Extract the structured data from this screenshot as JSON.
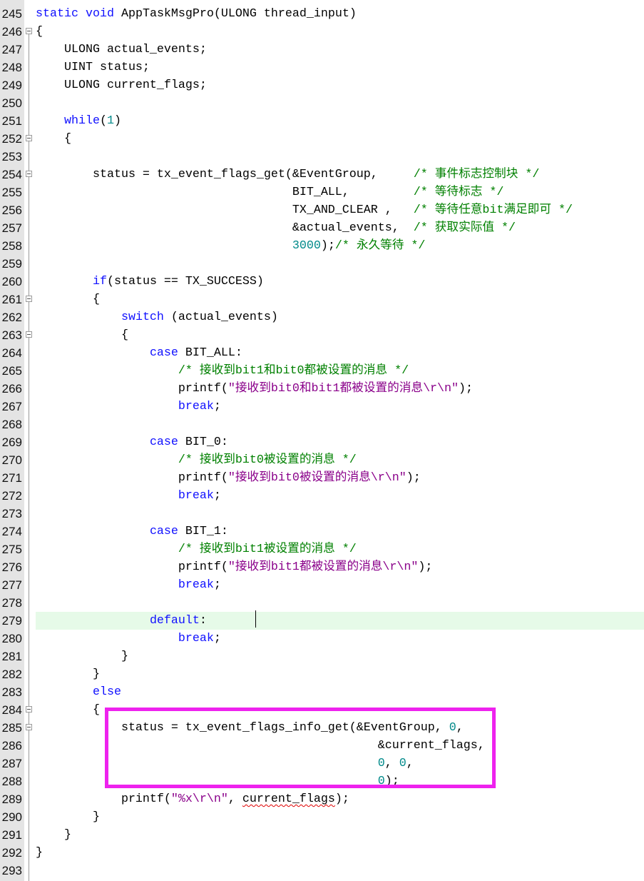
{
  "editor": {
    "highlight_line": "279",
    "annotation_box_color": "#ee22ee",
    "colors": {
      "keyword": "#1010ff",
      "number": "#008a8a",
      "comment": "#008000",
      "string": "#8a008a"
    },
    "lines": [
      {
        "num": "245",
        "segs": [
          [
            "k",
            "static"
          ],
          [
            "t",
            " "
          ],
          [
            "k",
            "void"
          ],
          [
            "t",
            " AppTaskMsgPro(ULONG thread_input)"
          ]
        ]
      },
      {
        "num": "246",
        "fold": true,
        "segs": [
          [
            "t",
            "{"
          ]
        ]
      },
      {
        "num": "247",
        "segs": [
          [
            "t",
            "    ULONG actual_events;"
          ]
        ]
      },
      {
        "num": "248",
        "segs": [
          [
            "t",
            "    UINT status;"
          ]
        ]
      },
      {
        "num": "249",
        "segs": [
          [
            "t",
            "    ULONG current_flags;"
          ]
        ]
      },
      {
        "num": "250",
        "segs": []
      },
      {
        "num": "251",
        "segs": [
          [
            "t",
            "    "
          ],
          [
            "k",
            "while"
          ],
          [
            "t",
            "("
          ],
          [
            "n",
            "1"
          ],
          [
            "t",
            ")"
          ]
        ]
      },
      {
        "num": "252",
        "fold": true,
        "segs": [
          [
            "t",
            "    {"
          ]
        ]
      },
      {
        "num": "253",
        "segs": []
      },
      {
        "num": "254",
        "fold": true,
        "segs": [
          [
            "t",
            "        status = tx_event_flags_get(&EventGroup,     "
          ],
          [
            "c",
            "/* 事件标志控制块 */"
          ]
        ]
      },
      {
        "num": "255",
        "segs": [
          [
            "t",
            "                                    BIT_ALL,         "
          ],
          [
            "c",
            "/* 等待标志 */"
          ]
        ]
      },
      {
        "num": "256",
        "segs": [
          [
            "t",
            "                                    TX_AND_CLEAR ,   "
          ],
          [
            "c",
            "/* 等待任意bit满足即可 */"
          ]
        ]
      },
      {
        "num": "257",
        "segs": [
          [
            "t",
            "                                    &actual_events,  "
          ],
          [
            "c",
            "/* 获取实际值 */"
          ]
        ]
      },
      {
        "num": "258",
        "segs": [
          [
            "t",
            "                                    "
          ],
          [
            "n",
            "3000"
          ],
          [
            "t",
            ");"
          ],
          [
            "c",
            "/* 永久等待 */"
          ]
        ]
      },
      {
        "num": "259",
        "segs": []
      },
      {
        "num": "260",
        "segs": [
          [
            "t",
            "        "
          ],
          [
            "k",
            "if"
          ],
          [
            "t",
            "(status == TX_SUCCESS)"
          ]
        ]
      },
      {
        "num": "261",
        "fold": true,
        "segs": [
          [
            "t",
            "        {"
          ]
        ]
      },
      {
        "num": "262",
        "segs": [
          [
            "t",
            "            "
          ],
          [
            "k",
            "switch"
          ],
          [
            "t",
            " (actual_events)"
          ]
        ]
      },
      {
        "num": "263",
        "fold": true,
        "segs": [
          [
            "t",
            "            {"
          ]
        ]
      },
      {
        "num": "264",
        "segs": [
          [
            "t",
            "                "
          ],
          [
            "k",
            "case"
          ],
          [
            "t",
            " BIT_ALL:"
          ]
        ]
      },
      {
        "num": "265",
        "segs": [
          [
            "t",
            "                    "
          ],
          [
            "c",
            "/* 接收到bit1和bit0都被设置的消息 */"
          ]
        ]
      },
      {
        "num": "266",
        "segs": [
          [
            "t",
            "                    printf("
          ],
          [
            "s",
            "\"接收到bit0和bit1都被设置的消息\\r\\n\""
          ],
          [
            "t",
            ");"
          ]
        ]
      },
      {
        "num": "267",
        "segs": [
          [
            "t",
            "                    "
          ],
          [
            "k",
            "break"
          ],
          [
            "t",
            ";"
          ]
        ]
      },
      {
        "num": "268",
        "segs": []
      },
      {
        "num": "269",
        "segs": [
          [
            "t",
            "                "
          ],
          [
            "k",
            "case"
          ],
          [
            "t",
            " BIT_0:"
          ]
        ]
      },
      {
        "num": "270",
        "segs": [
          [
            "t",
            "                    "
          ],
          [
            "c",
            "/* 接收到bit0被设置的消息 */"
          ]
        ]
      },
      {
        "num": "271",
        "segs": [
          [
            "t",
            "                    printf("
          ],
          [
            "s",
            "\"接收到bit0被设置的消息\\r\\n\""
          ],
          [
            "t",
            ");"
          ]
        ]
      },
      {
        "num": "272",
        "segs": [
          [
            "t",
            "                    "
          ],
          [
            "k",
            "break"
          ],
          [
            "t",
            ";"
          ]
        ]
      },
      {
        "num": "273",
        "segs": []
      },
      {
        "num": "274",
        "segs": [
          [
            "t",
            "                "
          ],
          [
            "k",
            "case"
          ],
          [
            "t",
            " BIT_1:"
          ]
        ]
      },
      {
        "num": "275",
        "segs": [
          [
            "t",
            "                    "
          ],
          [
            "c",
            "/* 接收到bit1被设置的消息 */"
          ]
        ]
      },
      {
        "num": "276",
        "segs": [
          [
            "t",
            "                    printf("
          ],
          [
            "s",
            "\"接收到bit1都被设置的消息\\r\\n\""
          ],
          [
            "t",
            ");"
          ]
        ]
      },
      {
        "num": "277",
        "segs": [
          [
            "t",
            "                    "
          ],
          [
            "k",
            "break"
          ],
          [
            "t",
            ";"
          ]
        ]
      },
      {
        "num": "278",
        "segs": []
      },
      {
        "num": "279",
        "segs": [
          [
            "t",
            "                "
          ],
          [
            "k",
            "default"
          ],
          [
            "t",
            ":"
          ]
        ]
      },
      {
        "num": "280",
        "segs": [
          [
            "t",
            "                    "
          ],
          [
            "k",
            "break"
          ],
          [
            "t",
            ";"
          ]
        ]
      },
      {
        "num": "281",
        "segs": [
          [
            "t",
            "            }"
          ]
        ]
      },
      {
        "num": "282",
        "segs": [
          [
            "t",
            "        }"
          ]
        ]
      },
      {
        "num": "283",
        "segs": [
          [
            "t",
            "        "
          ],
          [
            "k",
            "else"
          ]
        ]
      },
      {
        "num": "284",
        "fold": true,
        "segs": [
          [
            "t",
            "        {"
          ]
        ]
      },
      {
        "num": "285",
        "fold": true,
        "segs": [
          [
            "t",
            "            status = tx_event_flags_info_get(&EventGroup, "
          ],
          [
            "n",
            "0"
          ],
          [
            "t",
            ","
          ]
        ]
      },
      {
        "num": "286",
        "segs": [
          [
            "t",
            "                                                &current_flags,"
          ]
        ]
      },
      {
        "num": "287",
        "segs": [
          [
            "t",
            "                                                "
          ],
          [
            "n",
            "0"
          ],
          [
            "t",
            ", "
          ],
          [
            "n",
            "0"
          ],
          [
            "t",
            ","
          ]
        ]
      },
      {
        "num": "288",
        "segs": [
          [
            "t",
            "                                                "
          ],
          [
            "n",
            "0"
          ],
          [
            "t",
            ");"
          ]
        ]
      },
      {
        "num": "289",
        "segs": [
          [
            "t",
            "            printf("
          ],
          [
            "s",
            "\"%x\\r\\n\""
          ],
          [
            "t",
            ", "
          ],
          [
            "u",
            "current_flags"
          ],
          [
            "t",
            ");"
          ]
        ]
      },
      {
        "num": "290",
        "segs": [
          [
            "t",
            "        }"
          ]
        ]
      },
      {
        "num": "291",
        "segs": [
          [
            "t",
            "    }"
          ]
        ]
      },
      {
        "num": "292",
        "segs": [
          [
            "t",
            "}"
          ]
        ]
      },
      {
        "num": "293",
        "segs": []
      }
    ]
  }
}
